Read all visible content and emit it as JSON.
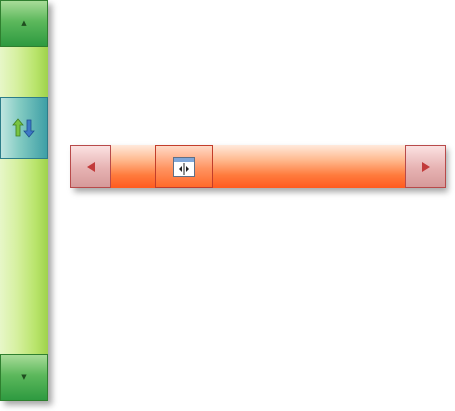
{
  "vertical_scrollbar": {
    "up_icon": "chevron-up-icon",
    "down_icon": "chevron-down-icon",
    "up_glyph": "▲",
    "down_glyph": "▼",
    "thumb_icon": "up-down-arrows-icon",
    "colors": {
      "track": "#c9ec84",
      "buttons": "#2e9a40",
      "thumb": "#3e9fa6",
      "arrow_up": "#78c442",
      "arrow_down": "#3d78c6"
    }
  },
  "horizontal_scrollbar": {
    "left_icon": "chevron-left-icon",
    "right_icon": "chevron-right-icon",
    "thumb_icon": "split-panes-icon",
    "colors": {
      "track": "#ff7b3d",
      "buttons": "#e6b2b2",
      "thumb": "#ff6a2a",
      "arrow": "#c23a3a"
    }
  }
}
